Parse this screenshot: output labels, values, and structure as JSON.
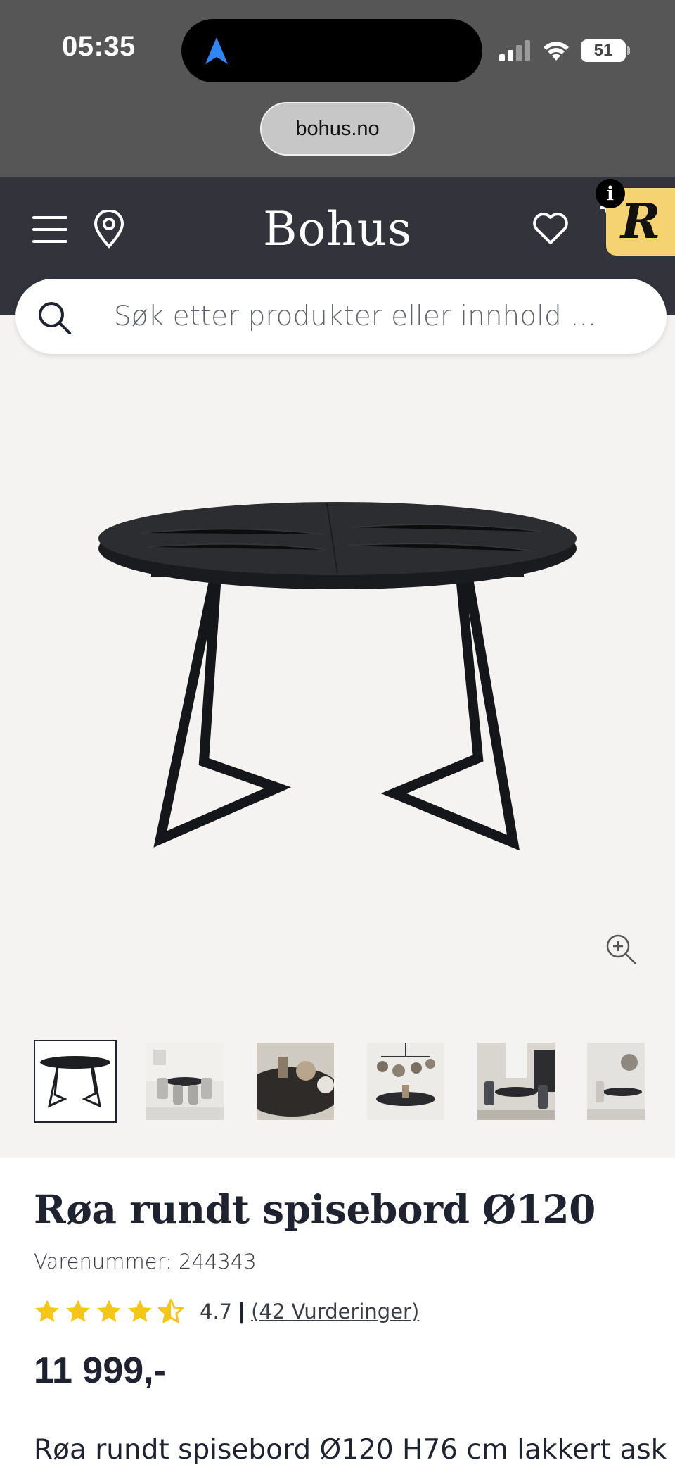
{
  "status_bar": {
    "time": "05:35",
    "battery": "51",
    "icons": [
      "location-arrow-icon",
      "signal-icon",
      "wifi-icon",
      "battery-icon"
    ]
  },
  "browser": {
    "url": "bohus.no"
  },
  "header": {
    "logo": "Bohus",
    "info_badge": "i",
    "r_badge": "R",
    "icons": [
      "menu-icon",
      "location-pin-icon",
      "heart-icon",
      "cart-icon"
    ]
  },
  "search": {
    "placeholder": "Søk etter produkter eller innhold ..."
  },
  "gallery": {
    "thumbnail_count": 6,
    "active_thumbnail": 0
  },
  "product": {
    "title": "Røa rundt spisebord Ø120",
    "sku": "Varenummer: 244343",
    "rating_value": "4.7",
    "rating_separator": "|",
    "rating_count": "(42 Vurderinger)",
    "rating_stars": 4.7,
    "price": "11 999,-",
    "description": "Røa rundt spisebord Ø120 H76 cm lakkert ask"
  },
  "colors": {
    "chrome": "#565656",
    "header": "#33343b",
    "gallery_bg": "#f4f3f1",
    "star": "#f5c518",
    "r_badge": "#f6d372",
    "location_arrow": "#2f86f6"
  }
}
